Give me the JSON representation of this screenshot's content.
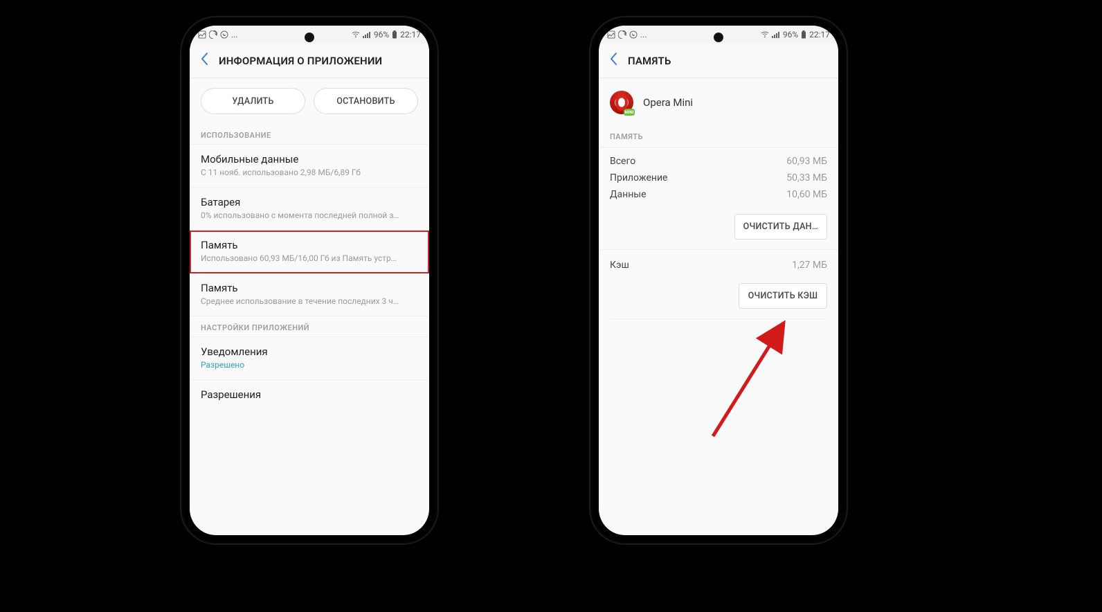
{
  "status": {
    "left_more": "...",
    "battery_text": "96%",
    "time": "22:17"
  },
  "left": {
    "header_title": "ИНФОРМАЦИЯ О ПРИЛОЖЕНИИ",
    "delete_btn": "УДАЛИТЬ",
    "stop_btn": "ОСТАНОВИТЬ",
    "section_usage": "ИСПОЛЬЗОВАНИЕ",
    "mobile_data_title": "Мобильные данные",
    "mobile_data_sub": "С 11 нояб. использовано 2,98 МБ/6,89 Гб",
    "battery_title": "Батарея",
    "battery_sub": "0% использовано с момента последней полной з…",
    "storage_title": "Память",
    "storage_sub": "Использовано 60,93 МБ/16,00 Гб из Память устр…",
    "memory_title": "Память",
    "memory_sub": "Среднее использование в течение последних 3 ч…",
    "section_settings": "НАСТРОЙКИ ПРИЛОЖЕНИЙ",
    "notifications_title": "Уведомления",
    "notifications_sub": "Разрешено",
    "permissions_title": "Разрешения"
  },
  "right": {
    "header_title": "ПАМЯТЬ",
    "app_name": "Opera Mini",
    "section_memory": "ПАМЯТЬ",
    "rows": {
      "total_label": "Всего",
      "total_value": "60,93 МБ",
      "app_label": "Приложение",
      "app_value": "50,33 МБ",
      "data_label": "Данные",
      "data_value": "10,60 МБ"
    },
    "clear_data_btn": "ОЧИСТИТЬ ДАН…",
    "cache_label": "Кэш",
    "cache_value": "1,27 МБ",
    "clear_cache_btn": "ОЧИСТИТЬ КЭШ"
  },
  "icons": {
    "opera_badge": "MINI"
  }
}
